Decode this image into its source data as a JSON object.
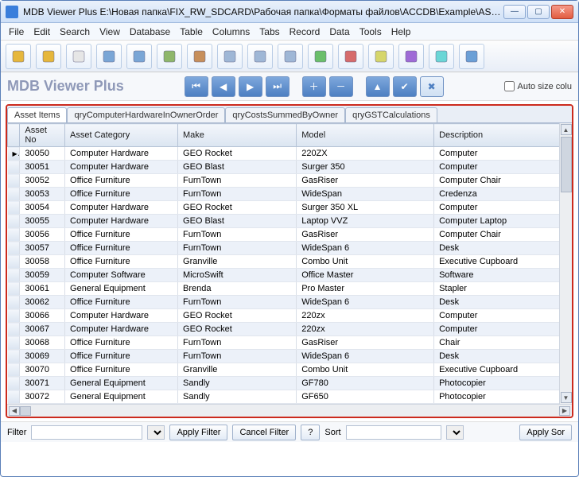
{
  "window": {
    "title": "MDB Viewer Plus E:\\Новая папка\\FIX_RW_SDCARD\\Рабочая папка\\Форматы файлов\\ACCDB\\Example\\ASa..."
  },
  "menu": [
    "File",
    "Edit",
    "Search",
    "View",
    "Database",
    "Table",
    "Columns",
    "Tabs",
    "Record",
    "Data",
    "Tools",
    "Help"
  ],
  "toolbar_icons": [
    "folder-open-icon",
    "folder-recent-icon",
    "blank-doc-icon",
    "search-icon",
    "zoom-icon",
    "sql-icon",
    "db-server-icon",
    "table-icon",
    "table-green-icon",
    "column-select-icon",
    "row-add-icon",
    "row-delete-icon",
    "sort-icon",
    "font-ab-icon",
    "data-icon",
    "db-tree-icon"
  ],
  "brand": "MDB Viewer Plus",
  "nav_icons": [
    "first-icon",
    "prev-icon",
    "next-icon",
    "last-icon",
    "plus-icon",
    "minus-icon",
    "edit-icon",
    "check-icon",
    "cancel-icon"
  ],
  "auto_size_label": "Auto size colu",
  "tabs": [
    {
      "label": "Asset Items",
      "active": true
    },
    {
      "label": "qryComputerHardwareInOwnerOrder",
      "active": false
    },
    {
      "label": "qryCostsSummedByOwner",
      "active": false
    },
    {
      "label": "qryGSTCalculations",
      "active": false
    }
  ],
  "columns": [
    "Asset No",
    "Asset Category",
    "Make",
    "Model",
    "Description"
  ],
  "rows": [
    {
      "sel": true,
      "no": "30050",
      "cat": "Computer Hardware",
      "make": "GEO Rocket",
      "model": "220ZX",
      "desc": "Computer"
    },
    {
      "sel": false,
      "no": "30051",
      "cat": "Computer Hardware",
      "make": "GEO Blast",
      "model": "Surger 350",
      "desc": "Computer"
    },
    {
      "sel": false,
      "no": "30052",
      "cat": "Office Furniture",
      "make": "FurnTown",
      "model": "GasRiser",
      "desc": "Computer Chair"
    },
    {
      "sel": false,
      "no": "30053",
      "cat": "Office Furniture",
      "make": "FurnTown",
      "model": "WideSpan",
      "desc": "Credenza"
    },
    {
      "sel": false,
      "no": "30054",
      "cat": "Computer Hardware",
      "make": "GEO Rocket",
      "model": "Surger 350 XL",
      "desc": "Computer"
    },
    {
      "sel": false,
      "no": "30055",
      "cat": "Computer Hardware",
      "make": "GEO Blast",
      "model": "Laptop VVZ",
      "desc": "Computer Laptop"
    },
    {
      "sel": false,
      "no": "30056",
      "cat": "Office Furniture",
      "make": "FurnTown",
      "model": "GasRiser",
      "desc": "Computer Chair"
    },
    {
      "sel": false,
      "no": "30057",
      "cat": "Office Furniture",
      "make": "FurnTown",
      "model": "WideSpan 6",
      "desc": "Desk"
    },
    {
      "sel": false,
      "no": "30058",
      "cat": "Office Furniture",
      "make": "Granville",
      "model": "Combo Unit",
      "desc": "Executive Cupboard"
    },
    {
      "sel": false,
      "no": "30059",
      "cat": "Computer Software",
      "make": "MicroSwift",
      "model": "Office Master",
      "desc": "Software"
    },
    {
      "sel": false,
      "no": "30061",
      "cat": "General Equipment",
      "make": "Brenda",
      "model": "Pro Master",
      "desc": "Stapler"
    },
    {
      "sel": false,
      "no": "30062",
      "cat": "Office Furniture",
      "make": "FurnTown",
      "model": "WideSpan 6",
      "desc": "Desk"
    },
    {
      "sel": false,
      "no": "30066",
      "cat": "Computer Hardware",
      "make": "GEO Rocket",
      "model": "220zx",
      "desc": "Computer"
    },
    {
      "sel": false,
      "no": "30067",
      "cat": "Computer Hardware",
      "make": "GEO Rocket",
      "model": "220zx",
      "desc": "Computer"
    },
    {
      "sel": false,
      "no": "30068",
      "cat": "Office Furniture",
      "make": "FurnTown",
      "model": "GasRiser",
      "desc": "Chair"
    },
    {
      "sel": false,
      "no": "30069",
      "cat": "Office Furniture",
      "make": "FurnTown",
      "model": "WideSpan 6",
      "desc": "Desk"
    },
    {
      "sel": false,
      "no": "30070",
      "cat": "Office Furniture",
      "make": "Granville",
      "model": "Combo Unit",
      "desc": "Executive Cupboard"
    },
    {
      "sel": false,
      "no": "30071",
      "cat": "General Equipment",
      "make": "Sandly",
      "model": "GF780",
      "desc": "Photocopier"
    },
    {
      "sel": false,
      "no": "30072",
      "cat": "General Equipment",
      "make": "Sandly",
      "model": "GF650",
      "desc": "Photocopier"
    }
  ],
  "footer": {
    "filter_label": "Filter",
    "apply_filter": "Apply Filter",
    "cancel_filter": "Cancel Filter",
    "question": "?",
    "sort_label": "Sort",
    "apply_sort": "Apply Sor"
  }
}
